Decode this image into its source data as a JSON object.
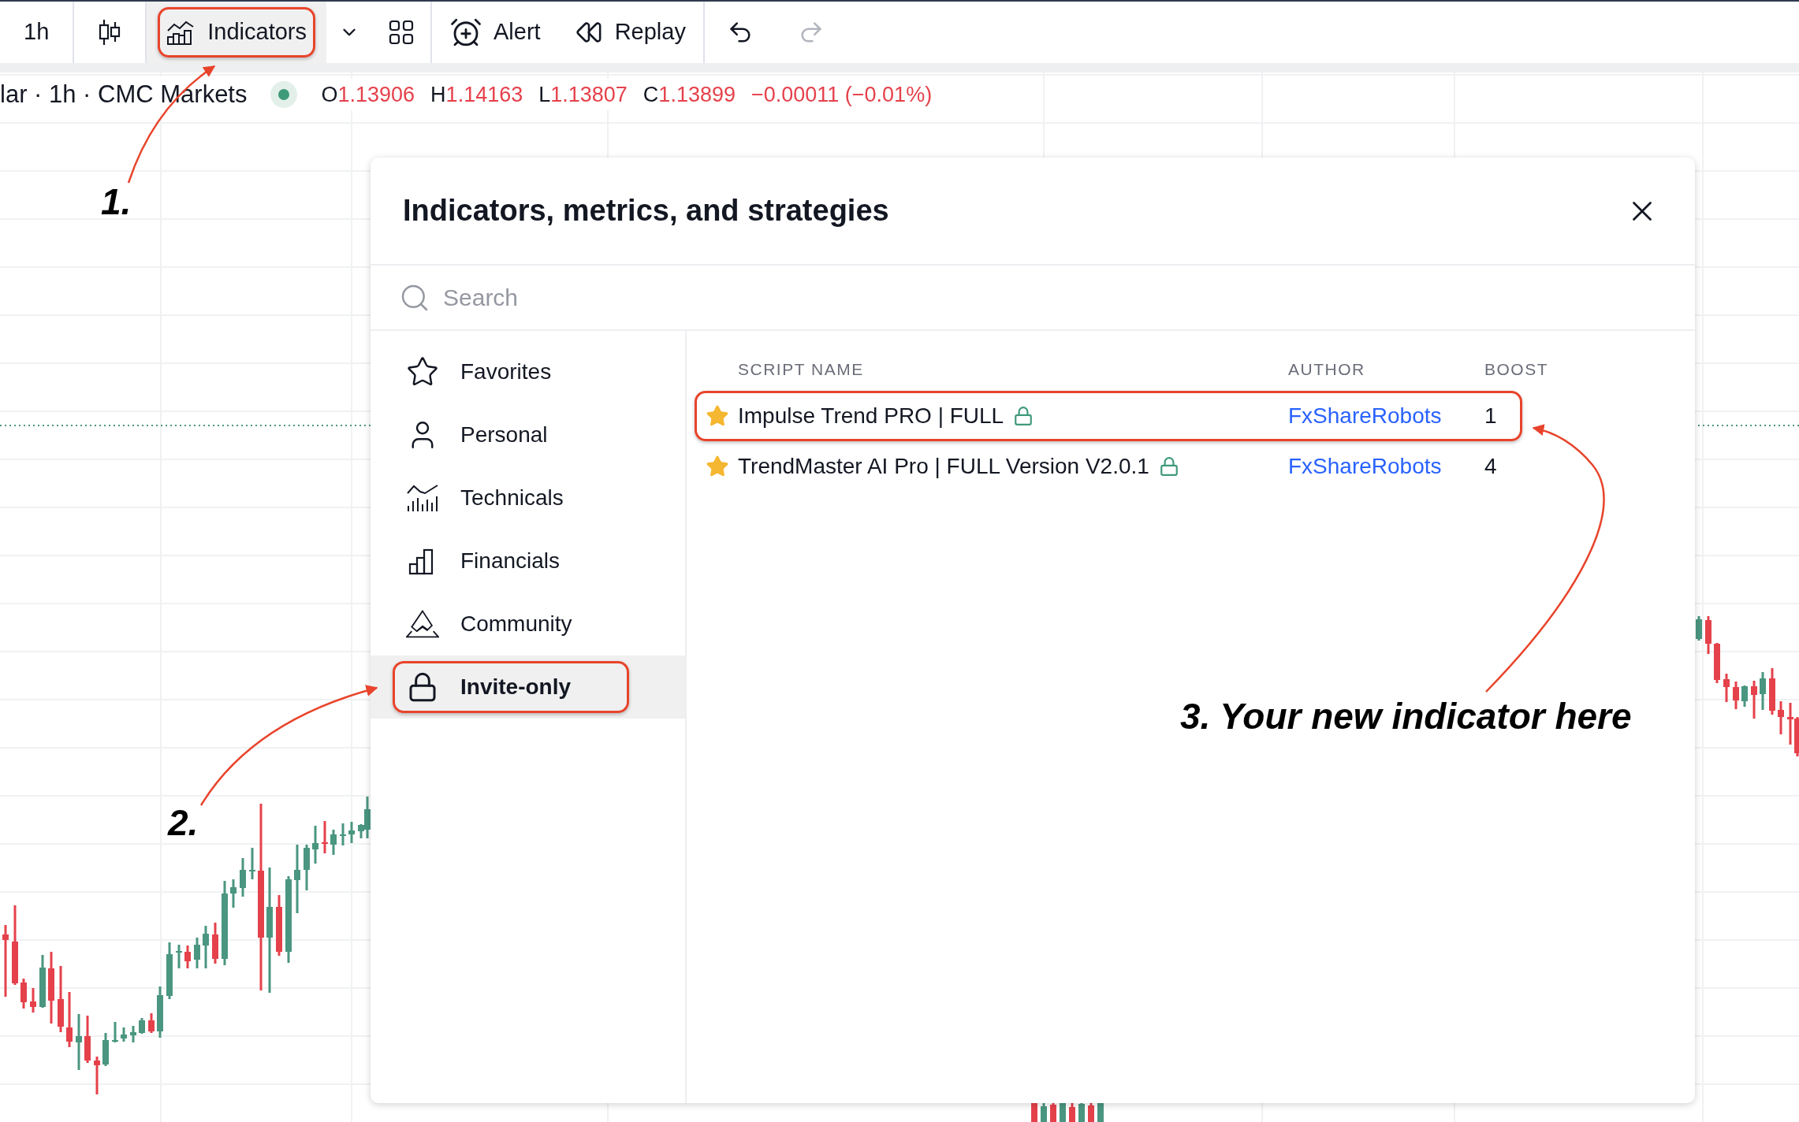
{
  "toolbar": {
    "groups": [
      [
        {
          "kind": "interval",
          "label": "1h",
          "active": false
        }
      ],
      [
        {
          "kind": "chart_type",
          "active": false
        }
      ],
      [
        {
          "kind": "indicators",
          "label": "Indicators",
          "active": true,
          "annotated": true
        },
        {
          "kind": "dropdown",
          "active": false
        },
        {
          "kind": "layout",
          "active": false
        }
      ],
      [
        {
          "kind": "alert",
          "label": "Alert",
          "active": false
        },
        {
          "kind": "replay",
          "label": "Replay",
          "active": false
        }
      ],
      [
        {
          "kind": "undo",
          "disabled": false,
          "active": false
        },
        {
          "kind": "redo",
          "disabled": true,
          "active": false
        }
      ]
    ]
  },
  "legend": {
    "symbol": "lar · 1h · CMC Markets",
    "ohlc": [
      {
        "label": "O",
        "value": "1.13906"
      },
      {
        "label": "H",
        "value": "1.14163"
      },
      {
        "label": "L",
        "value": "1.13807"
      },
      {
        "label": "C",
        "value": "1.13899"
      }
    ],
    "change": "−0.00011 (−0.01%)"
  },
  "dialog": {
    "title": "Indicators, metrics, and strategies",
    "search": {
      "placeholder": "Search"
    },
    "categories": [
      {
        "label": "Favorites",
        "selected": false,
        "annotated": false
      },
      {
        "label": "Personal",
        "selected": false,
        "annotated": false
      },
      {
        "label": "Technicals",
        "selected": false,
        "annotated": false
      },
      {
        "label": "Financials",
        "selected": false,
        "annotated": false
      },
      {
        "label": "Community",
        "selected": false,
        "annotated": false
      },
      {
        "label": "Invite-only",
        "selected": true,
        "annotated": true
      }
    ],
    "table": {
      "columns": [
        "SCRIPT NAME",
        "AUTHOR",
        "BOOST"
      ],
      "rows": [
        {
          "name": "Impulse Trend PRO | FULL",
          "favorite": true,
          "locked": true,
          "author": "FxShareRobots",
          "boost": "1",
          "annotated": true
        },
        {
          "name": "TrendMaster AI Pro | FULL Version V2.0.1",
          "favorite": true,
          "locked": true,
          "author": "FxShareRobots",
          "boost": "4",
          "annotated": false
        }
      ]
    }
  },
  "annotations": [
    {
      "label": "1."
    },
    {
      "label": "2."
    },
    {
      "label": "3. Your new indicator here"
    }
  ]
}
